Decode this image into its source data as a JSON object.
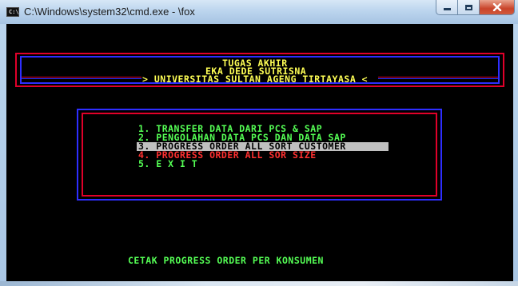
{
  "window": {
    "title": "C:\\Windows\\system32\\cmd.exe - \\fox",
    "icon_label": "C:\\",
    "buttons": [
      "minimize",
      "maximize",
      "close"
    ]
  },
  "header": {
    "line1": "TUGAS AKHIR",
    "line2": "EKA DEDE SUTRISNA",
    "line3": "> UNIVERSITAS SULTAN AGENG TIRTAYASA <"
  },
  "menu": {
    "items": [
      {
        "label": "1. TRANSFER DATA DARI PCS & SAP",
        "color": "#55ff55"
      },
      {
        "label": "2. PENGOLAHAN DATA PCS DAN DATA SAP",
        "color": "#55ff55"
      },
      {
        "label": "3. PROGRESS ORDER ALL SORT CUSTOMER",
        "color": "#000000",
        "selected": true
      },
      {
        "label": "4. PROGRESS ORDER ALL SOR SIZE",
        "color": "#ff3030"
      },
      {
        "label": "5. E X I T",
        "color": "#55ff55"
      }
    ]
  },
  "status": {
    "text": "CETAK PROGRESS ORDER PER KONSUMEN"
  },
  "colors": {
    "frame_red": "#e0002a",
    "frame_blue": "#2e2eff",
    "text_yellow": "#ffff55",
    "text_green": "#55ff55",
    "selection_bg": "#c0c0c0"
  }
}
